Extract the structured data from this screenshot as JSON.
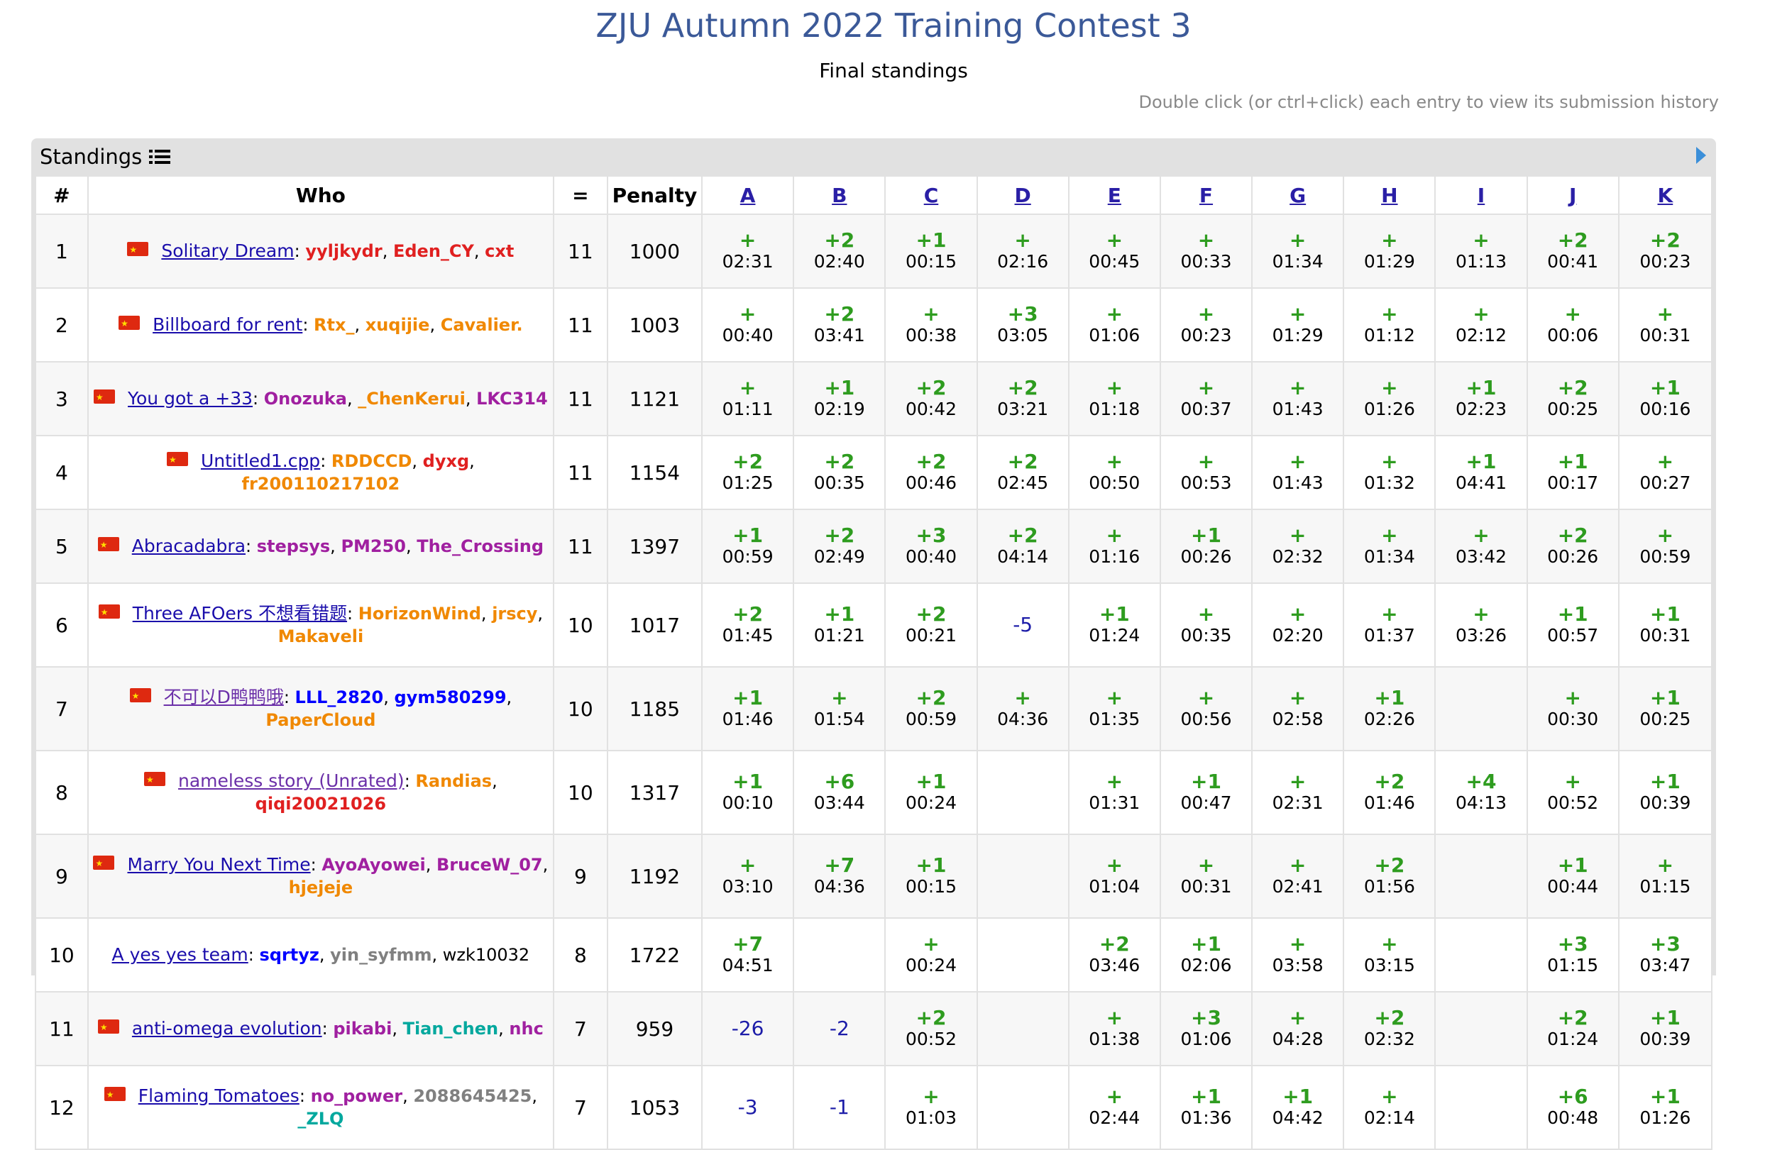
{
  "title": "ZJU Autumn 2022 Training Contest 3",
  "subtitle": "Final standings",
  "hint": "Double click (or ctrl+click) each entry to view its submission history",
  "panel": {
    "label": "Standings"
  },
  "headers": {
    "rank": "#",
    "who": "Who",
    "solved": "=",
    "penalty": "Penalty"
  },
  "problems": [
    "A",
    "B",
    "C",
    "D",
    "E",
    "F",
    "G",
    "H",
    "I",
    "J",
    "K"
  ],
  "rows": [
    {
      "rank": "1",
      "flag": "CN",
      "team": "Solitary Dream",
      "visited": false,
      "members": [
        {
          "name": "yyljkydr",
          "color": "red"
        },
        {
          "name": "Eden_CY",
          "color": "red"
        },
        {
          "name": "cxt",
          "color": "red"
        }
      ],
      "solved": "11",
      "penalty": "1000",
      "cells": [
        {
          "r": "+",
          "t": "02:31"
        },
        {
          "r": "+2",
          "t": "02:40"
        },
        {
          "r": "+1",
          "t": "00:15"
        },
        {
          "r": "+",
          "t": "02:16"
        },
        {
          "r": "+",
          "t": "00:45"
        },
        {
          "r": "+",
          "t": "00:33"
        },
        {
          "r": "+",
          "t": "01:34"
        },
        {
          "r": "+",
          "t": "01:29"
        },
        {
          "r": "+",
          "t": "01:13"
        },
        {
          "r": "+2",
          "t": "00:41"
        },
        {
          "r": "+2",
          "t": "00:23"
        }
      ]
    },
    {
      "rank": "2",
      "flag": "CN",
      "team": "Billboard for rent",
      "visited": false,
      "members": [
        {
          "name": "Rtx_",
          "color": "orange"
        },
        {
          "name": "xuqijie",
          "color": "orange"
        },
        {
          "name": "Cavalier.",
          "color": "orange"
        }
      ],
      "solved": "11",
      "penalty": "1003",
      "cells": [
        {
          "r": "+",
          "t": "00:40"
        },
        {
          "r": "+2",
          "t": "03:41"
        },
        {
          "r": "+",
          "t": "00:38"
        },
        {
          "r": "+3",
          "t": "03:05"
        },
        {
          "r": "+",
          "t": "01:06"
        },
        {
          "r": "+",
          "t": "00:23"
        },
        {
          "r": "+",
          "t": "01:29"
        },
        {
          "r": "+",
          "t": "01:12"
        },
        {
          "r": "+",
          "t": "02:12"
        },
        {
          "r": "+",
          "t": "00:06"
        },
        {
          "r": "+",
          "t": "00:31"
        }
      ]
    },
    {
      "rank": "3",
      "flag": "CN",
      "team": "You got a +33",
      "visited": false,
      "members": [
        {
          "name": "Onozuka",
          "color": "purple"
        },
        {
          "name": "_ChenKerui",
          "color": "orange"
        },
        {
          "name": "LKC314",
          "color": "purple"
        }
      ],
      "solved": "11",
      "penalty": "1121",
      "cells": [
        {
          "r": "+",
          "t": "01:11"
        },
        {
          "r": "+1",
          "t": "02:19"
        },
        {
          "r": "+2",
          "t": "00:42"
        },
        {
          "r": "+2",
          "t": "03:21"
        },
        {
          "r": "+",
          "t": "01:18"
        },
        {
          "r": "+",
          "t": "00:37"
        },
        {
          "r": "+",
          "t": "01:43"
        },
        {
          "r": "+",
          "t": "01:26"
        },
        {
          "r": "+1",
          "t": "02:23"
        },
        {
          "r": "+2",
          "t": "00:25"
        },
        {
          "r": "+1",
          "t": "00:16"
        }
      ]
    },
    {
      "rank": "4",
      "flag": "CN",
      "team": "Untitled1.cpp",
      "visited": false,
      "members": [
        {
          "name": "RDDCCD",
          "color": "orange"
        },
        {
          "name": "dyxg",
          "color": "red"
        },
        {
          "name": "fr200110217102",
          "color": "orange"
        }
      ],
      "solved": "11",
      "penalty": "1154",
      "cells": [
        {
          "r": "+2",
          "t": "01:25"
        },
        {
          "r": "+2",
          "t": "00:35"
        },
        {
          "r": "+2",
          "t": "00:46"
        },
        {
          "r": "+2",
          "t": "02:45"
        },
        {
          "r": "+",
          "t": "00:50"
        },
        {
          "r": "+",
          "t": "00:53"
        },
        {
          "r": "+",
          "t": "01:43"
        },
        {
          "r": "+",
          "t": "01:32"
        },
        {
          "r": "+1",
          "t": "04:41"
        },
        {
          "r": "+1",
          "t": "00:17"
        },
        {
          "r": "+",
          "t": "00:27"
        }
      ]
    },
    {
      "rank": "5",
      "flag": "CN",
      "team": "Abracadabra",
      "visited": false,
      "members": [
        {
          "name": "stepsys",
          "color": "purple"
        },
        {
          "name": "PM250",
          "color": "purple"
        },
        {
          "name": "The_Crossing",
          "color": "purple"
        }
      ],
      "solved": "11",
      "penalty": "1397",
      "cells": [
        {
          "r": "+1",
          "t": "00:59"
        },
        {
          "r": "+2",
          "t": "02:49"
        },
        {
          "r": "+3",
          "t": "00:40"
        },
        {
          "r": "+2",
          "t": "04:14"
        },
        {
          "r": "+",
          "t": "01:16"
        },
        {
          "r": "+1",
          "t": "00:26"
        },
        {
          "r": "+",
          "t": "02:32"
        },
        {
          "r": "+",
          "t": "01:34"
        },
        {
          "r": "+",
          "t": "03:42"
        },
        {
          "r": "+2",
          "t": "00:26"
        },
        {
          "r": "+",
          "t": "00:59"
        }
      ]
    },
    {
      "rank": "6",
      "flag": "CN",
      "team": "Three AFOers 不想看错题",
      "visited": false,
      "members": [
        {
          "name": "HorizonWind",
          "color": "orange"
        },
        {
          "name": "jrscy",
          "color": "orange"
        },
        {
          "name": "Makaveli",
          "color": "orange"
        }
      ],
      "solved": "10",
      "penalty": "1017",
      "cells": [
        {
          "r": "+2",
          "t": "01:45"
        },
        {
          "r": "+1",
          "t": "01:21"
        },
        {
          "r": "+2",
          "t": "00:21"
        },
        {
          "r": "-5",
          "t": ""
        },
        {
          "r": "+1",
          "t": "01:24"
        },
        {
          "r": "+",
          "t": "00:35"
        },
        {
          "r": "+",
          "t": "02:20"
        },
        {
          "r": "+",
          "t": "01:37"
        },
        {
          "r": "+",
          "t": "03:26"
        },
        {
          "r": "+1",
          "t": "00:57"
        },
        {
          "r": "+1",
          "t": "00:31"
        }
      ]
    },
    {
      "rank": "7",
      "flag": "CN",
      "team": "不可以D鸭鸭哦",
      "visited": true,
      "members": [
        {
          "name": "LLL_2820",
          "color": "blue"
        },
        {
          "name": "gym580299",
          "color": "blue"
        },
        {
          "name": "PaperCloud",
          "color": "orange"
        }
      ],
      "solved": "10",
      "penalty": "1185",
      "cells": [
        {
          "r": "+1",
          "t": "01:46"
        },
        {
          "r": "+",
          "t": "01:54"
        },
        {
          "r": "+2",
          "t": "00:59"
        },
        {
          "r": "+",
          "t": "04:36"
        },
        {
          "r": "+",
          "t": "01:35"
        },
        {
          "r": "+",
          "t": "00:56"
        },
        {
          "r": "+",
          "t": "02:58"
        },
        {
          "r": "+1",
          "t": "02:26"
        },
        {
          "r": "",
          "t": ""
        },
        {
          "r": "+",
          "t": "00:30"
        },
        {
          "r": "+1",
          "t": "00:25"
        }
      ]
    },
    {
      "rank": "8",
      "flag": "CN",
      "team": "nameless story (Unrated)",
      "visited": true,
      "members": [
        {
          "name": "Randias",
          "color": "orange"
        },
        {
          "name": "qiqi20021026",
          "color": "red"
        }
      ],
      "solved": "10",
      "penalty": "1317",
      "cells": [
        {
          "r": "+1",
          "t": "00:10"
        },
        {
          "r": "+6",
          "t": "03:44"
        },
        {
          "r": "+1",
          "t": "00:24"
        },
        {
          "r": "",
          "t": ""
        },
        {
          "r": "+",
          "t": "01:31"
        },
        {
          "r": "+1",
          "t": "00:47"
        },
        {
          "r": "+",
          "t": "02:31"
        },
        {
          "r": "+2",
          "t": "01:46"
        },
        {
          "r": "+4",
          "t": "04:13"
        },
        {
          "r": "+",
          "t": "00:52"
        },
        {
          "r": "+1",
          "t": "00:39"
        }
      ]
    },
    {
      "rank": "9",
      "flag": "CN",
      "team": "Marry You Next Time",
      "visited": false,
      "members": [
        {
          "name": "AyoAyowei",
          "color": "purple"
        },
        {
          "name": "BruceW_07",
          "color": "purple"
        },
        {
          "name": "hjejeje",
          "color": "orange"
        }
      ],
      "solved": "9",
      "penalty": "1192",
      "cells": [
        {
          "r": "+",
          "t": "03:10"
        },
        {
          "r": "+7",
          "t": "04:36"
        },
        {
          "r": "+1",
          "t": "00:15"
        },
        {
          "r": "",
          "t": ""
        },
        {
          "r": "+",
          "t": "01:04"
        },
        {
          "r": "+",
          "t": "00:31"
        },
        {
          "r": "+",
          "t": "02:41"
        },
        {
          "r": "+2",
          "t": "01:56"
        },
        {
          "r": "",
          "t": ""
        },
        {
          "r": "+1",
          "t": "00:44"
        },
        {
          "r": "+",
          "t": "01:15"
        }
      ]
    },
    {
      "rank": "10",
      "flag": "",
      "team": "A yes yes team",
      "visited": false,
      "members": [
        {
          "name": "sqrtyz",
          "color": "blue"
        },
        {
          "name": "yin_syfmm",
          "color": "gray"
        },
        {
          "name": "wzk10032",
          "color": "black"
        }
      ],
      "solved": "8",
      "penalty": "1722",
      "cells": [
        {
          "r": "+7",
          "t": "04:51"
        },
        {
          "r": "",
          "t": ""
        },
        {
          "r": "+",
          "t": "00:24"
        },
        {
          "r": "",
          "t": ""
        },
        {
          "r": "+2",
          "t": "03:46"
        },
        {
          "r": "+1",
          "t": "02:06"
        },
        {
          "r": "+",
          "t": "03:58"
        },
        {
          "r": "+",
          "t": "03:15"
        },
        {
          "r": "",
          "t": ""
        },
        {
          "r": "+3",
          "t": "01:15"
        },
        {
          "r": "+3",
          "t": "03:47"
        }
      ]
    },
    {
      "rank": "11",
      "flag": "CN",
      "team": "anti-omega evolution",
      "visited": false,
      "members": [
        {
          "name": "pikabi",
          "color": "purple"
        },
        {
          "name": "Tian_chen",
          "color": "cyan"
        },
        {
          "name": "nhc",
          "color": "purple"
        }
      ],
      "solved": "7",
      "penalty": "959",
      "cells": [
        {
          "r": "-26",
          "t": ""
        },
        {
          "r": "-2",
          "t": ""
        },
        {
          "r": "+2",
          "t": "00:52"
        },
        {
          "r": "",
          "t": ""
        },
        {
          "r": "+",
          "t": "01:38"
        },
        {
          "r": "+3",
          "t": "01:06"
        },
        {
          "r": "+",
          "t": "04:28"
        },
        {
          "r": "+2",
          "t": "02:32"
        },
        {
          "r": "",
          "t": ""
        },
        {
          "r": "+2",
          "t": "01:24"
        },
        {
          "r": "+1",
          "t": "00:39"
        }
      ]
    },
    {
      "rank": "12",
      "flag": "CN",
      "team": "Flaming Tomatoes",
      "visited": false,
      "members": [
        {
          "name": "no_power",
          "color": "purple"
        },
        {
          "name": "2088645425",
          "color": "gray"
        },
        {
          "name": "_ZLQ",
          "color": "cyan"
        }
      ],
      "solved": "7",
      "penalty": "1053",
      "cells": [
        {
          "r": "-3",
          "t": ""
        },
        {
          "r": "-1",
          "t": ""
        },
        {
          "r": "+",
          "t": "01:03"
        },
        {
          "r": "",
          "t": ""
        },
        {
          "r": "+",
          "t": "02:44"
        },
        {
          "r": "+1",
          "t": "01:36"
        },
        {
          "r": "+1",
          "t": "04:42"
        },
        {
          "r": "+",
          "t": "02:14"
        },
        {
          "r": "",
          "t": ""
        },
        {
          "r": "+6",
          "t": "00:48"
        },
        {
          "r": "+1",
          "t": "01:26"
        }
      ]
    }
  ],
  "colors": {
    "title": "#3b5998",
    "accepted": "#2e9c1f",
    "rejected": "#1c1ca8",
    "link": "#1a0dab",
    "panel": "#e1e1e1",
    "row_alt": "#f7f7f7"
  }
}
